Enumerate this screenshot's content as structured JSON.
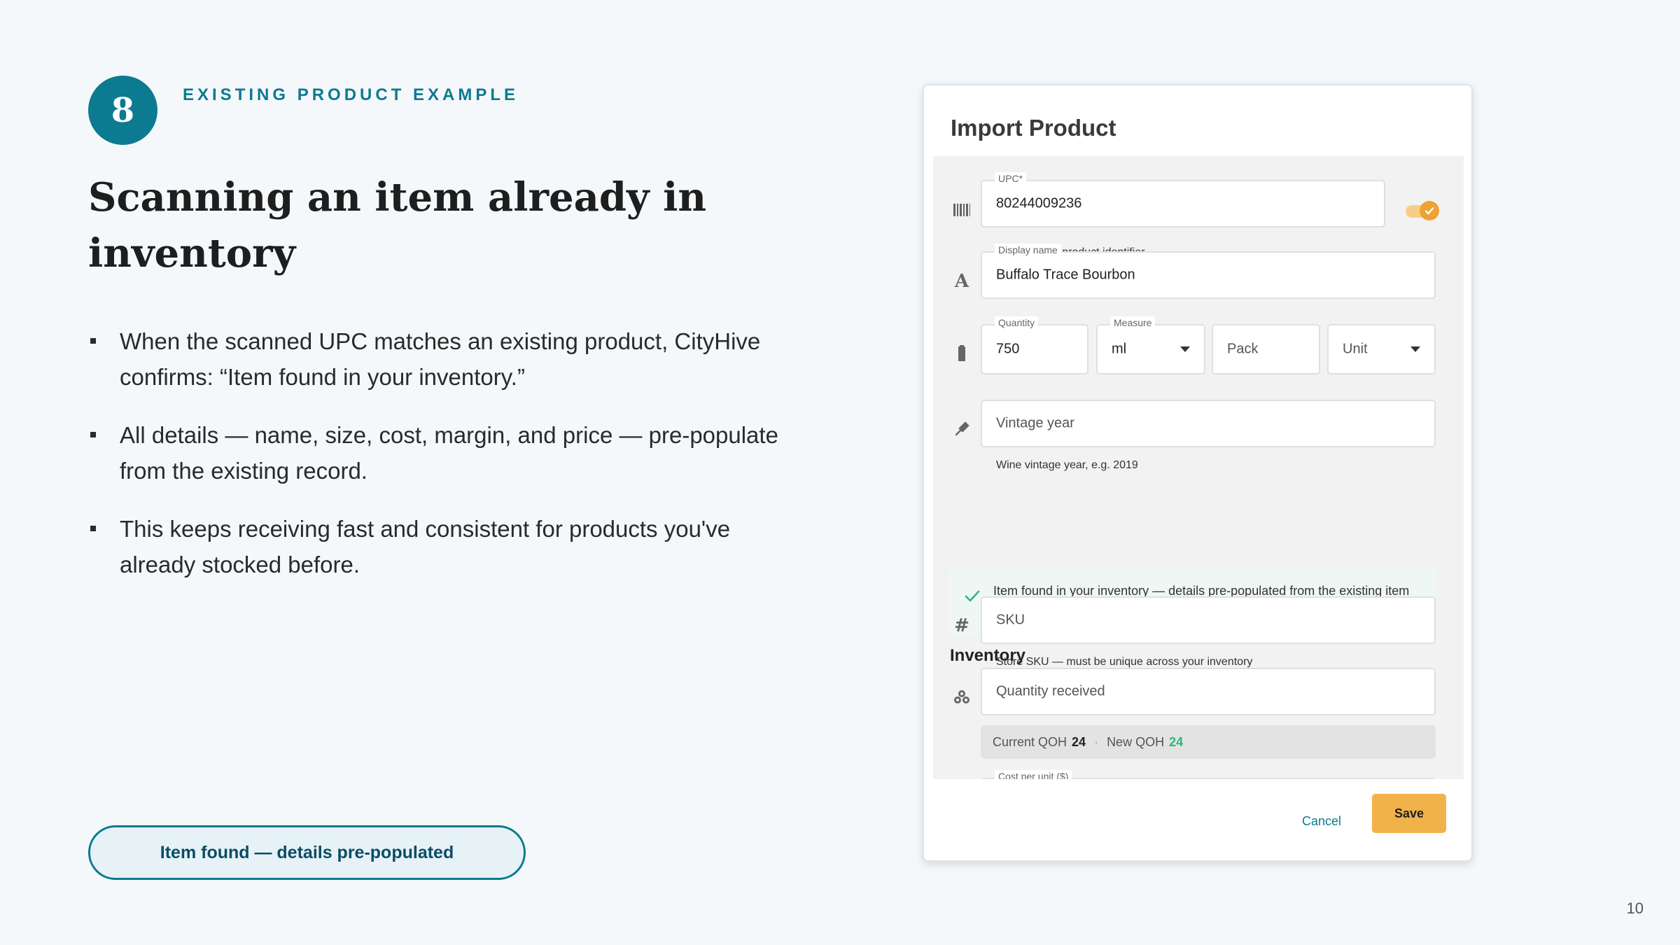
{
  "slide": {
    "step_number": "8",
    "eyebrow": "EXISTING PRODUCT EXAMPLE",
    "title": "Scanning an item already in inventory",
    "bullets": [
      "When the scanned UPC matches an existing product, CityHive confirms: “Item found in your inventory.”",
      "All details — name, size, cost, margin, and price — pre-populate from the existing record.",
      "This keeps receiving fast and consistent for products you've already stocked before."
    ],
    "status_pill": "Item found — details pre-populated",
    "page_number": "10"
  },
  "dialog": {
    "title": "Import Product",
    "upc": {
      "label": "UPC*",
      "value": "80244009236",
      "hint": "UPC or EAN product identifier",
      "icon": "barcode-icon",
      "toggle_on": true
    },
    "display_name": {
      "label": "Display name",
      "value": "Buffalo Trace Bourbon",
      "icon": "text-a-icon"
    },
    "quantity": {
      "label": "Quantity",
      "value": "750",
      "icon": "bottle-icon"
    },
    "measure": {
      "label": "Measure",
      "value": "ml"
    },
    "pack": {
      "placeholder": "Pack"
    },
    "unit": {
      "value": "Unit"
    },
    "vintage": {
      "placeholder": "Vintage year",
      "hint": "Wine vintage year, e.g. 2019",
      "icon": "wine-pour-icon"
    },
    "found_message": "Item found in your inventory — details pre-populated from the existing item",
    "inventory_heading": "Inventory",
    "sku": {
      "placeholder": "SKU",
      "hint": "Store SKU — must be unique across your inventory",
      "icon": "hash-icon"
    },
    "quantity_received": {
      "placeholder": "Quantity received",
      "icon": "stack-icon"
    },
    "qoh": {
      "current_label": "Current QOH",
      "current_value": "24",
      "new_label": "New QOH",
      "new_value": "24"
    },
    "cost_per_unit": {
      "label": "Cost per unit ($)"
    },
    "buttons": {
      "cancel": "Cancel",
      "save": "Save"
    }
  },
  "colors": {
    "accent": "#0c7a90",
    "save": "#f2b24a",
    "toggle": "#eea233",
    "success": "#2db67a"
  }
}
